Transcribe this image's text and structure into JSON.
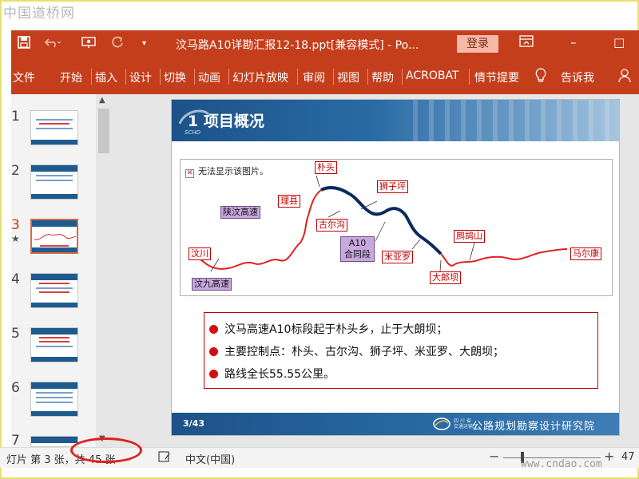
{
  "watermark_top": "中国道桥网",
  "watermark_bottom": "www.cndao.com",
  "titlebar": {
    "title": "汶马路A10详勘汇报12-18.ppt[兼容模式]  -  Po...",
    "login": "登录",
    "save_icon": "floppy-disk-icon",
    "undo_icon": "undo-icon",
    "redo_icon": "redo-icon",
    "present_icon": "presentation-icon",
    "customize_icon": "chevron-down-icon",
    "ribbon_display_icon": "ribbon-display-icon",
    "minimize": "–",
    "maximize": "□"
  },
  "ribbon": {
    "tabs": [
      "文件",
      "开始",
      "插入",
      "设计",
      "切换",
      "动画",
      "幻灯片放映",
      "审阅",
      "视图",
      "帮助",
      "ACROBAT",
      "情节提要"
    ],
    "tell_me": "告诉我",
    "tell_me_icon": "lightbulb-icon"
  },
  "thumbnails": [
    {
      "num": "1"
    },
    {
      "num": "2"
    },
    {
      "num": "3",
      "active": true
    },
    {
      "num": "4"
    },
    {
      "num": "5"
    },
    {
      "num": "6"
    },
    {
      "num": "7"
    }
  ],
  "slide": {
    "title": "1 项目概况",
    "logo_sub": "SCHD",
    "broken_image": "无法显示该图片。",
    "map_labels": {
      "wenchuan": "汶川",
      "wenjiu": "汶九高速",
      "shaanwan": "陕汶高速",
      "lixian": "理县",
      "putou": "朴头",
      "guergou": "古尔沟",
      "shiziping": "狮子坪",
      "a10_line1": "A10",
      "a10_line2": "合同段",
      "miyaluo": "米亚罗",
      "dalangba": "大郎坝",
      "zhegushan": "鹧鸪山",
      "maerkang": "马尔康"
    },
    "bullets": [
      "汶马高速A10标段起于朴头乡，止于大朗坝；",
      "主要控制点：朴头、古尔沟、狮子坪、米亚罗、大朗坝；",
      "路线全长55.55公里。"
    ],
    "slide_number": "3/43",
    "footer_org": "公路规划勘察设计研究院",
    "footer_sub_1": "四 川 省",
    "footer_sub_2": "交通运输厅"
  },
  "statusbar": {
    "slide_info": "灯片 第 3 张，共 45 张",
    "notes_icon": "notes-icon",
    "language": "中文(中国)",
    "zoom_minus": "−",
    "zoom_plus": "+",
    "zoom": "47"
  },
  "colors": {
    "accent": "#c43e1c",
    "slide_blue": "#1c5288",
    "route_red": "#e02020",
    "route_navy": "#0b2a5e"
  }
}
